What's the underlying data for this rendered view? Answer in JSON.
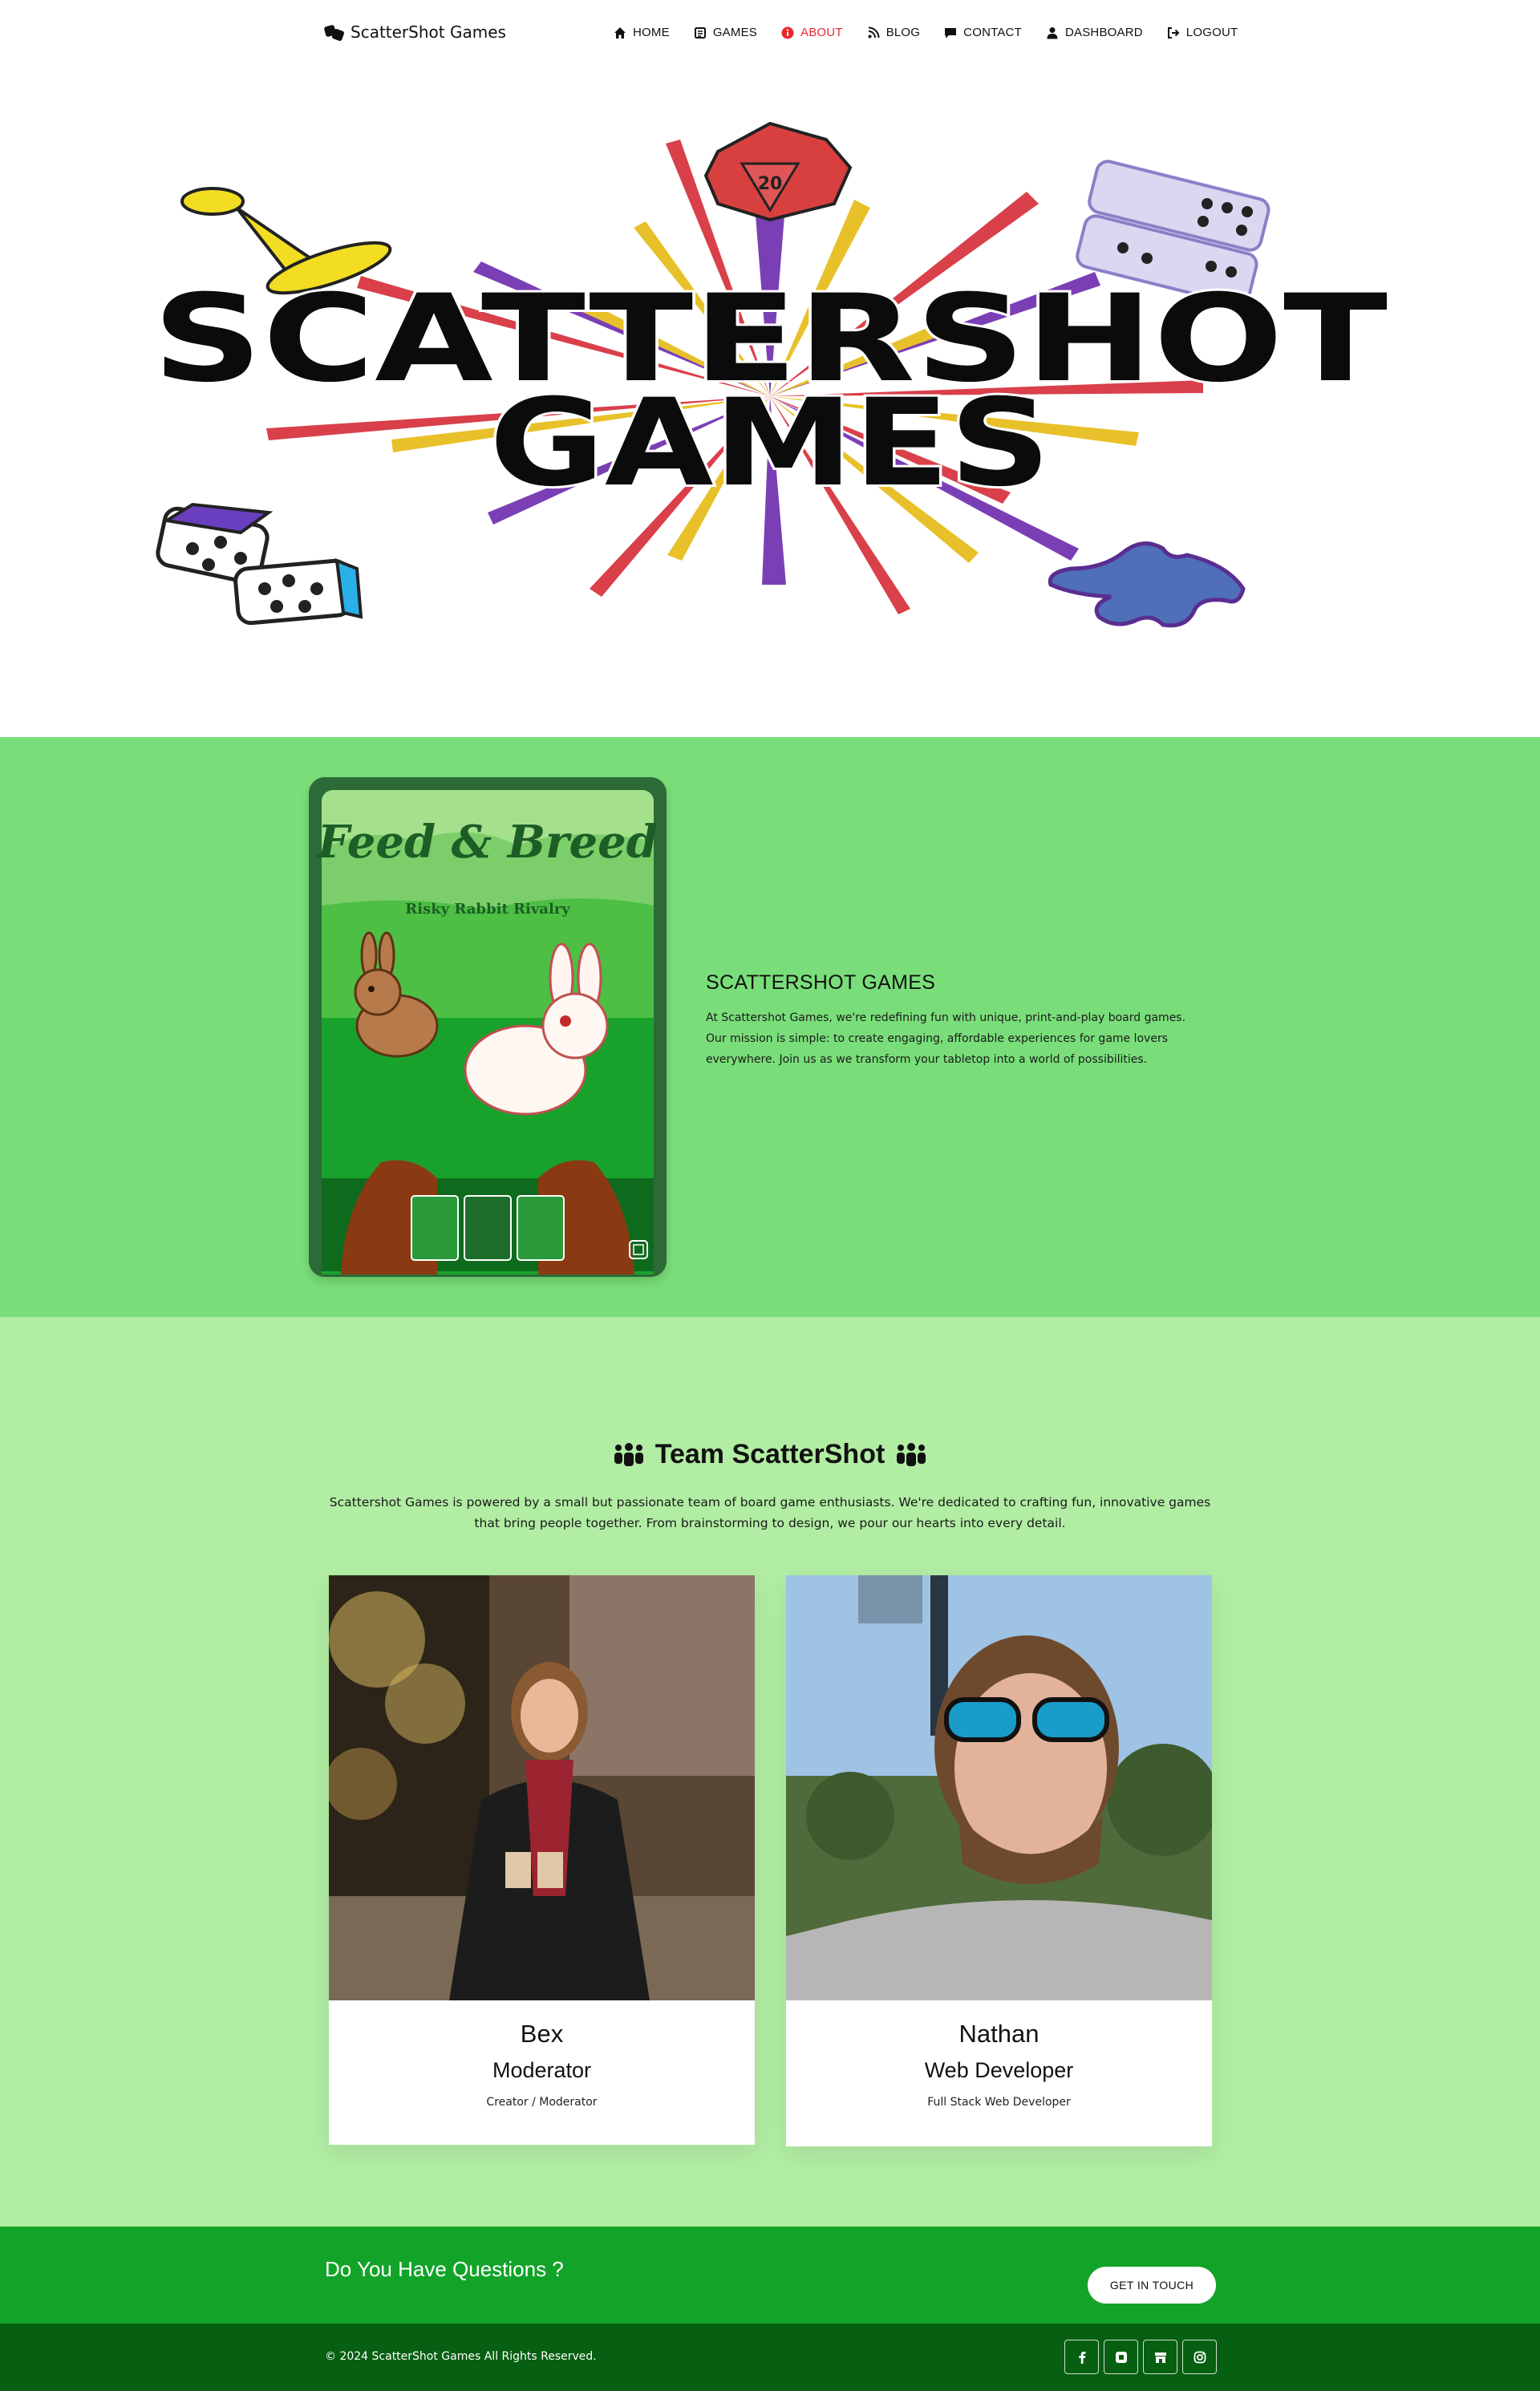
{
  "nav": {
    "brand": "ScatterShot Games",
    "items": [
      {
        "label": "HOME",
        "icon": "home-icon"
      },
      {
        "label": "GAMES",
        "icon": "games-icon"
      },
      {
        "label": "ABOUT",
        "icon": "info-icon",
        "active": true
      },
      {
        "label": "BLOG",
        "icon": "blog-icon"
      },
      {
        "label": "CONTACT",
        "icon": "chat-icon"
      },
      {
        "label": "DASHBOARD",
        "icon": "user-icon"
      },
      {
        "label": "LOGOUT",
        "icon": "logout-icon"
      }
    ]
  },
  "hero": {
    "logo_line1": "SCATTERSHOT",
    "logo_line2": "GAMES",
    "d20_number": "20"
  },
  "about": {
    "card_title": "Feed & Breed",
    "card_subtitle": "Risky Rabbit Rivalry",
    "title": "SCATTERSHOT GAMES",
    "body": "At Scattershot Games, we're redefining fun with unique, print-and-play board games. Our mission is simple: to create engaging, affordable experiences for game lovers everywhere. Join us as we transform your tabletop into a world of possibilities."
  },
  "team": {
    "title": "Team ScatterShot",
    "description": "Scattershot Games is powered by a small but passionate team of board game enthusiasts. We're dedicated to crafting fun, innovative games that bring people together. From brainstorming to design, we pour our hearts into every detail.",
    "members": [
      {
        "name": "Bex",
        "role": "Moderator",
        "subtitle": "Creator / Moderator"
      },
      {
        "name": "Nathan",
        "role": "Web Developer",
        "subtitle": "Full Stack Web Developer"
      }
    ]
  },
  "cta": {
    "text": "Do You Have Questions ?",
    "button": "GET IN TOUCH"
  },
  "footer": {
    "copyright": "© 2024 ScatterShot Games All Rights Reserved.",
    "socials": [
      "facebook-icon",
      "square-icon",
      "store-icon",
      "instagram-icon"
    ]
  },
  "colors": {
    "active_nav": "#e8262f",
    "about_bg": "#79de79",
    "team_bg": "#b1eda3",
    "cta_bg": "#12a329",
    "footer_bg": "#075f11"
  }
}
